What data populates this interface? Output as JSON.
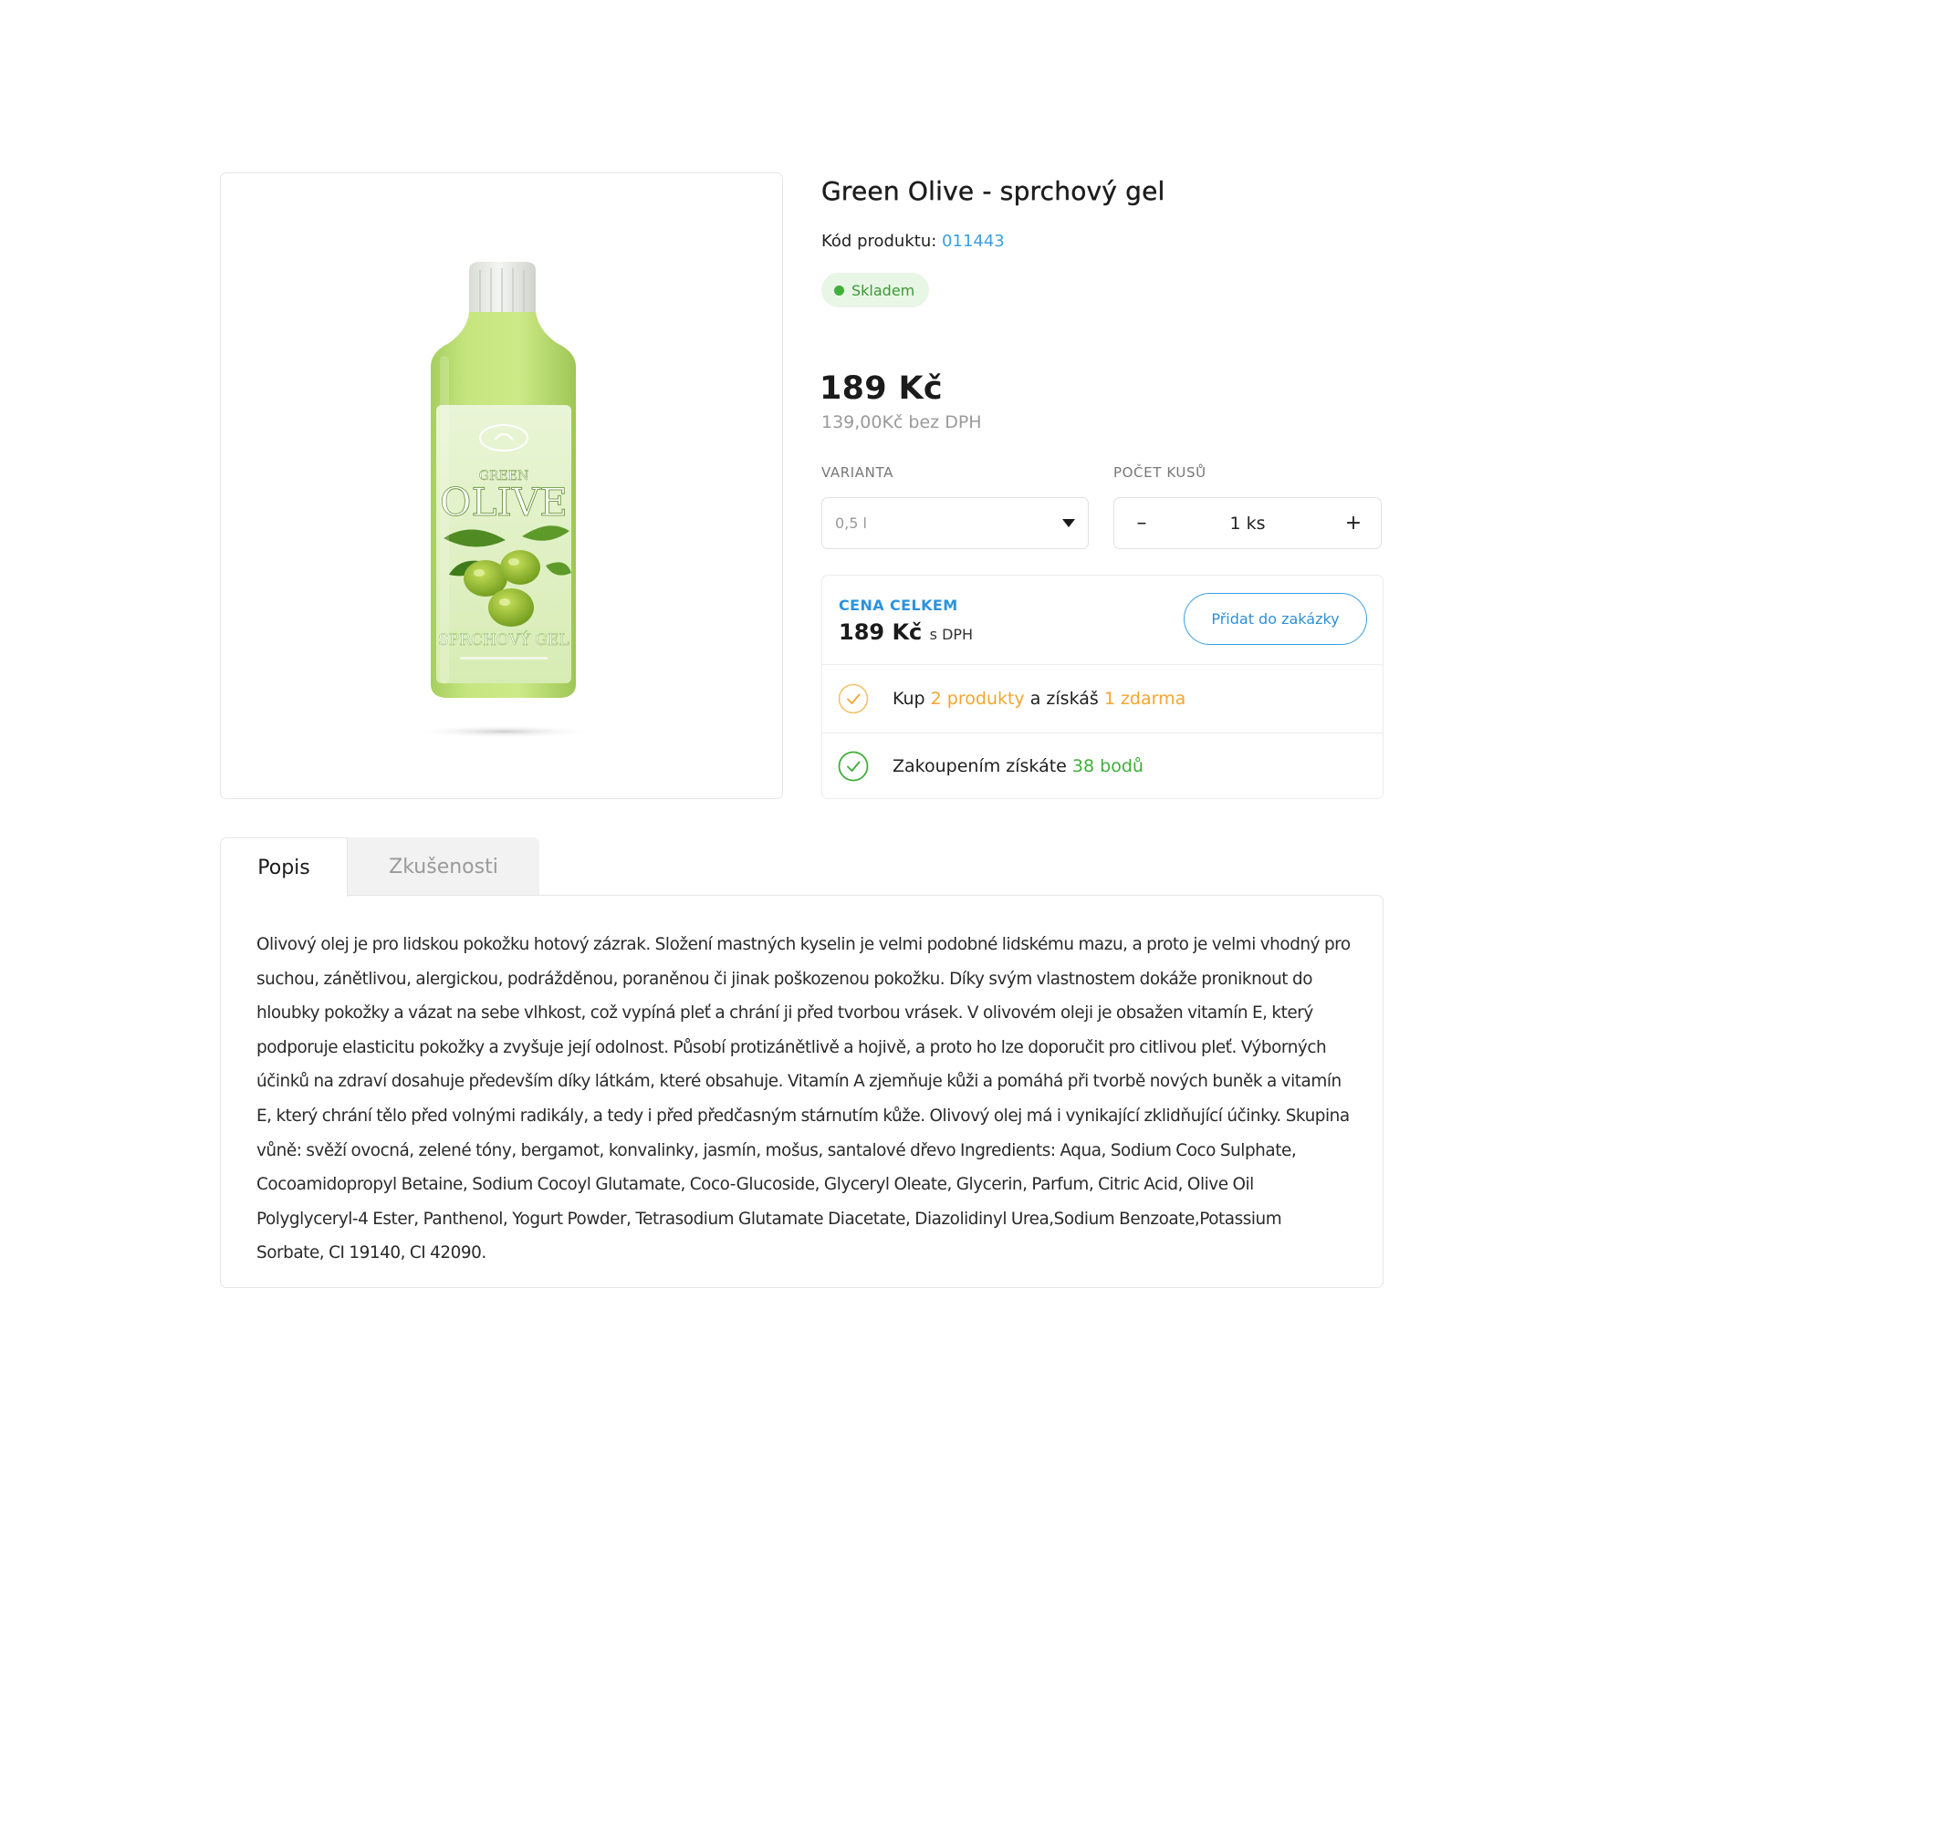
{
  "product": {
    "title": "Green Olive - sprchový gel",
    "code_label": "Kód produktu:",
    "code_value": "011443",
    "stock": "Skladem",
    "price": "189 Kč",
    "price_net": "139,00Kč bez DPH",
    "image": {
      "brand_small": "GREEN",
      "brand_big": "OLIVE",
      "label_bottom": "SPRCHOVÝ GEL"
    }
  },
  "variant": {
    "label": "VARIANTA",
    "value": "0,5 l"
  },
  "quantity": {
    "label": "POČET KUSŮ",
    "value": "1 ks",
    "minus": "–",
    "plus": "+"
  },
  "total": {
    "label": "CENA CELKEM",
    "price": "189 Kč",
    "vat": "s DPH",
    "add_button": "Přidat do zakázky"
  },
  "promos": {
    "buy_prefix": "Kup",
    "buy_count": "2 produkty",
    "buy_middle": "a získáš",
    "buy_free": "1 zdarma",
    "points_prefix": "Zakoupením získáte",
    "points_value": "38 bodů"
  },
  "tabs": {
    "description": "Popis",
    "reviews": "Zkušenosti"
  },
  "description_text": "Olivový olej je pro lidskou pokožku hotový zázrak. Složení mastných kyselin je velmi podobné lidskému mazu, a proto je velmi vhodný pro suchou, zánětlivou, alergickou, podrážděnou, poraněnou či jinak poškozenou pokožku. Díky svým vlastnostem dokáže proniknout do hloubky pokožky a vázat na sebe vlhkost, což vypíná pleť a chrání ji před tvorbou vrásek. V olivovém oleji je obsažen vitamín E, který podporuje elasticitu pokožky a zvyšuje její odolnost. Působí protizánětlivě a hojivě, a proto ho lze doporučit pro citlivou pleť. Výborných účinků na zdraví dosahuje především díky látkám, které obsahuje. Vitamín A zjemňuje kůži a pomáhá při tvorbě nových buněk a vitamín E, který chrání tělo před volnými radikály, a tedy i před předčasným stárnutím kůže. Olivový olej má i vynikající zklidňující účinky. Skupina vůně: svěží ovocná, zelené tóny, bergamot, konvalinky, jasmín, mošus, santalové dřevo Ingredients: Aqua, Sodium Coco Sulphate, Cocoamidopropyl Betaine, Sodium Cocoyl Glutamate, Coco-Glucoside, Glyceryl Oleate, Glycerin, Parfum, Citric Acid, Olive Oil Polyglyceryl-4 Ester, Panthenol, Yogurt Powder, Tetrasodium Glutamate Diacetate, Diazolidinyl Urea,Sodium Benzoate,Potassium Sorbate, CI 19140, CI 42090.",
  "colors": {
    "accent_blue": "#3b9fe0",
    "stock_green": "#3fb03a",
    "promo_orange": "#f2a631",
    "points_green": "#3fae3a"
  }
}
